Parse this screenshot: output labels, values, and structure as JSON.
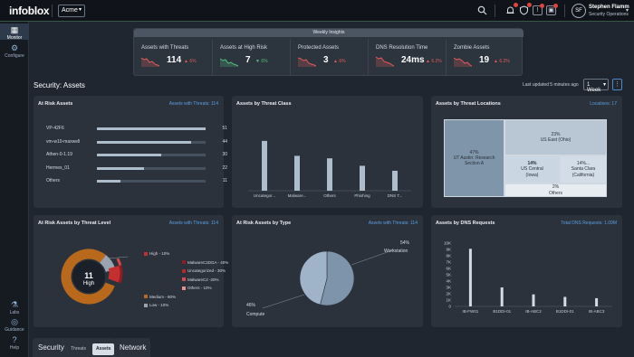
{
  "header": {
    "logo": "infoblox",
    "org": "Acme",
    "user_initials": "SF",
    "user_name": "Stephen Flamm",
    "user_role": "Security Operations"
  },
  "sidebar": {
    "items": [
      {
        "label": "Monitor",
        "icon": "grid-icon",
        "active": true
      },
      {
        "label": "Configure",
        "icon": "gear-icon",
        "active": false
      }
    ],
    "bottom": [
      {
        "label": "Labs",
        "icon": "flask-icon"
      },
      {
        "label": "Guidance",
        "icon": "compass-icon"
      },
      {
        "label": "Help",
        "icon": "help-icon"
      }
    ]
  },
  "insights": {
    "title": "Weekly Insights",
    "metrics": [
      {
        "label": "Assets with Threats",
        "value": "114",
        "delta": "6%",
        "trend": "up",
        "color": "#e25a5a"
      },
      {
        "label": "Assets at High Risk",
        "value": "7",
        "delta": "6%",
        "trend": "down",
        "color": "#52c07a"
      },
      {
        "label": "Protected Assets",
        "value": "3",
        "delta": "6%",
        "trend": "up",
        "color": "#e25a5a"
      },
      {
        "label": "DNS Resolution Time",
        "value": "24ms",
        "delta": "6.2%",
        "trend": "up",
        "color": "#e25a5a"
      },
      {
        "label": "Zombie Assets",
        "value": "19",
        "delta": "6.2%",
        "trend": "up",
        "color": "#e25a5a"
      }
    ]
  },
  "page": {
    "title": "Security: Assets",
    "last_updated": "Last updated 5 minutes ago",
    "range": "1 Week"
  },
  "at_risk_assets": {
    "title": "At Risk Assets",
    "link": "Assets with Threats: 114",
    "max": 51,
    "rows": [
      {
        "label": "VP-42F6",
        "value": 51
      },
      {
        "label": "vm-w10-maxwell",
        "value": 44
      },
      {
        "label": "Athen-0-1.19",
        "value": 30
      },
      {
        "label": "Hermes_01",
        "value": 22
      },
      {
        "label": "Others",
        "value": 11
      }
    ]
  },
  "threat_class": {
    "title": "Assets by Threat Class",
    "categories": [
      "Uncategor...",
      "Malware...",
      "Others",
      "Phishing",
      "DNS T..."
    ]
  },
  "threat_locations": {
    "title": "Assets by Threat Locations",
    "link": "Locations: 17",
    "cells": [
      {
        "pct": "47%",
        "name": "UT Austin: Research Section A"
      },
      {
        "pct": "23%",
        "name": "US East (Ohio)"
      },
      {
        "pct": "14%",
        "name": "US Central (Iowa)"
      },
      {
        "pct": "14%...",
        "name": "Santa Clara (California)"
      },
      {
        "pct": "2%",
        "name": "Others"
      }
    ]
  },
  "threat_level": {
    "title": "At Risk Assets by Threat Level",
    "link": "Assets with Threats: 114",
    "center_value": "11",
    "center_label": "High",
    "legend": [
      {
        "label": "High - 10%",
        "color": "#c62f2f",
        "indent": false
      },
      {
        "label": "MalwareC2DGA - 40%",
        "color": "#8a1e22",
        "indent": true
      },
      {
        "label": "Uncategorized - 30%",
        "color": "#b22a2a",
        "indent": true
      },
      {
        "label": "MalwareC2 -20%",
        "color": "#d24b4b",
        "indent": true
      },
      {
        "label": "Others - 10%",
        "color": "#e58f8f",
        "indent": true
      },
      {
        "label": "Medium - 80%",
        "color": "#b8691c",
        "indent": false
      },
      {
        "label": "Low - 10%",
        "color": "#9aa4b0",
        "indent": false
      }
    ]
  },
  "risk_by_type": {
    "title": "At Risk Assets by Type",
    "link": "Assets with Threats: 114",
    "slices": [
      {
        "label": "Workstation",
        "pct": "54%"
      },
      {
        "label": "Compute",
        "pct": "46%"
      }
    ]
  },
  "dns_requests": {
    "title": "Assets by DNS Requests",
    "link": "Total DNS Requests: 1.09M"
  },
  "chart_data": [
    {
      "type": "bar",
      "title": "Assets by Threat Class",
      "categories": [
        "Uncategor...",
        "Malware...",
        "Others",
        "Phishing",
        "DNS T..."
      ],
      "values": [
        40,
        28,
        26,
        20,
        16
      ],
      "color": "#aebdcc"
    },
    {
      "type": "pie",
      "title": "At Risk Assets by Type",
      "categories": [
        "Workstation",
        "Compute"
      ],
      "values": [
        54,
        46
      ],
      "colors": [
        "#7e94aa",
        "#9fb4c8"
      ]
    },
    {
      "type": "bar",
      "title": "Assets by DNS Requests",
      "categories": [
        "IB-FW01",
        "B1DDI-01",
        "IB-ABC2",
        "B1DDI-01",
        "IB-ABC3"
      ],
      "values": [
        9100,
        3000,
        1900,
        1500,
        1300
      ],
      "ylim": [
        0,
        10000
      ],
      "yticks": [
        "0",
        "1K",
        "2K",
        "3K",
        "4K",
        "5K",
        "6K",
        "7K",
        "8K",
        "9K",
        "10K"
      ],
      "color": "#d5dbe3"
    }
  ],
  "tabs": {
    "main": "Security",
    "sub": [
      "Threats",
      "Assets"
    ],
    "active_sub": "Assets",
    "network": "Network"
  }
}
